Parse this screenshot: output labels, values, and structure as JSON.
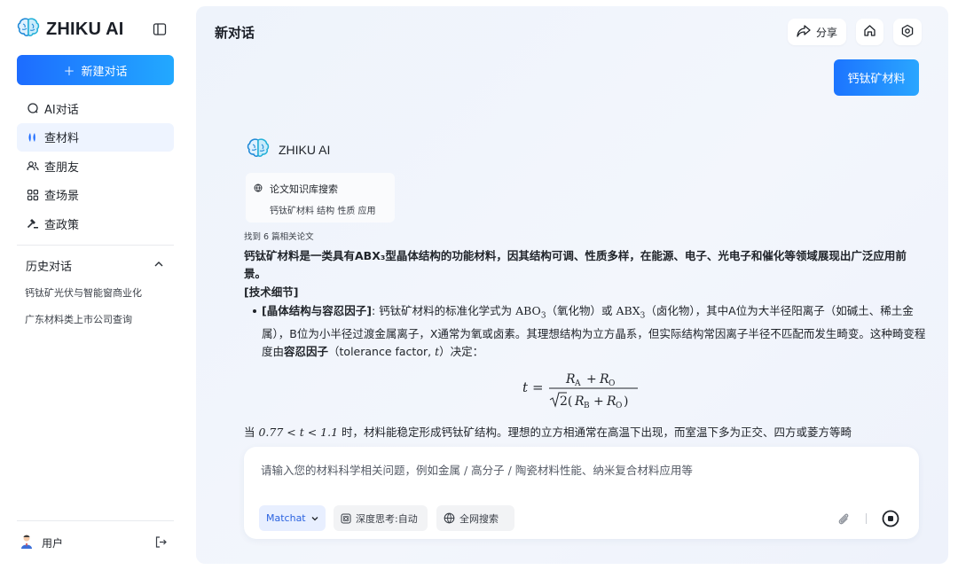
{
  "sidebar": {
    "brand": "ZHIKU AI",
    "new_chat": "新建对话",
    "nav": [
      {
        "label": "AI对话",
        "icon": "chat-icon"
      },
      {
        "label": "查材料",
        "icon": "materials-icon"
      },
      {
        "label": "查朋友",
        "icon": "people-icon"
      },
      {
        "label": "查场景",
        "icon": "grid-icon"
      },
      {
        "label": "查政策",
        "icon": "gavel-icon"
      }
    ],
    "active_index": 1,
    "history_title": "历史对话",
    "history": [
      "钙钛矿光伏与智能窗商业化",
      "广东材料类上市公司查询"
    ],
    "user": "用户"
  },
  "main": {
    "title": "新对话",
    "share": "分享",
    "user_message": "钙钛矿材料",
    "ai_name": "ZHIKU AI",
    "kb_title": "论文知识库搜索",
    "kb_query": "钙钛矿材料 结构 性质 应用",
    "found": "找到 6 篇相关论文",
    "lead": "钙钛矿材料是一类具有ABX₃型晶体结构的功能材料，因其结构可调、性质多样，在能源、电子、光电子和催化等领域展现出广泛应用前景。",
    "section": "[技术细节]",
    "bullet_label": "[晶体结构与容忍因子]",
    "bullet_text_1": ": 钙钛矿材料的标准化学式为 ",
    "abo3": "ABO",
    "abo3_sub": "3",
    "oxide": "（氧化物）或 ",
    "abx3": "ABX",
    "abx3_sub": "3",
    "bullet_text_2": "（卤化物），其中A位为大半径阳离子（如碱土、稀土金属），B位为小半径过渡金属离子，X通常为氧或卤素。其理想结构为立方晶系，但实际结构常因离子半径不匹配而发生畸变。这种畸变程度由",
    "tolerance_bold": "容忍因子",
    "tolerance_en": "（tolerance factor, ",
    "t_var": "t",
    "tolerance_end": "）决定：",
    "after_prefix": "当 ",
    "after_math": "0.77 < t < 1.1",
    "after_text": " 时，材料能稳定形成钙钛矿结构。理想的立方相通常在高温下出现，而室温下多为正交、四方或菱方等畸",
    "input_placeholder": "请输入您的材料科学相关问题，例如金属 / 高分子 / 陶瓷材料性能、纳米复合材料应用等",
    "model": "Matchat",
    "think": "深度思考:自动",
    "web": "全网搜索"
  },
  "colors": {
    "accent": "#1d6cff",
    "accent2": "#22a9ff"
  }
}
